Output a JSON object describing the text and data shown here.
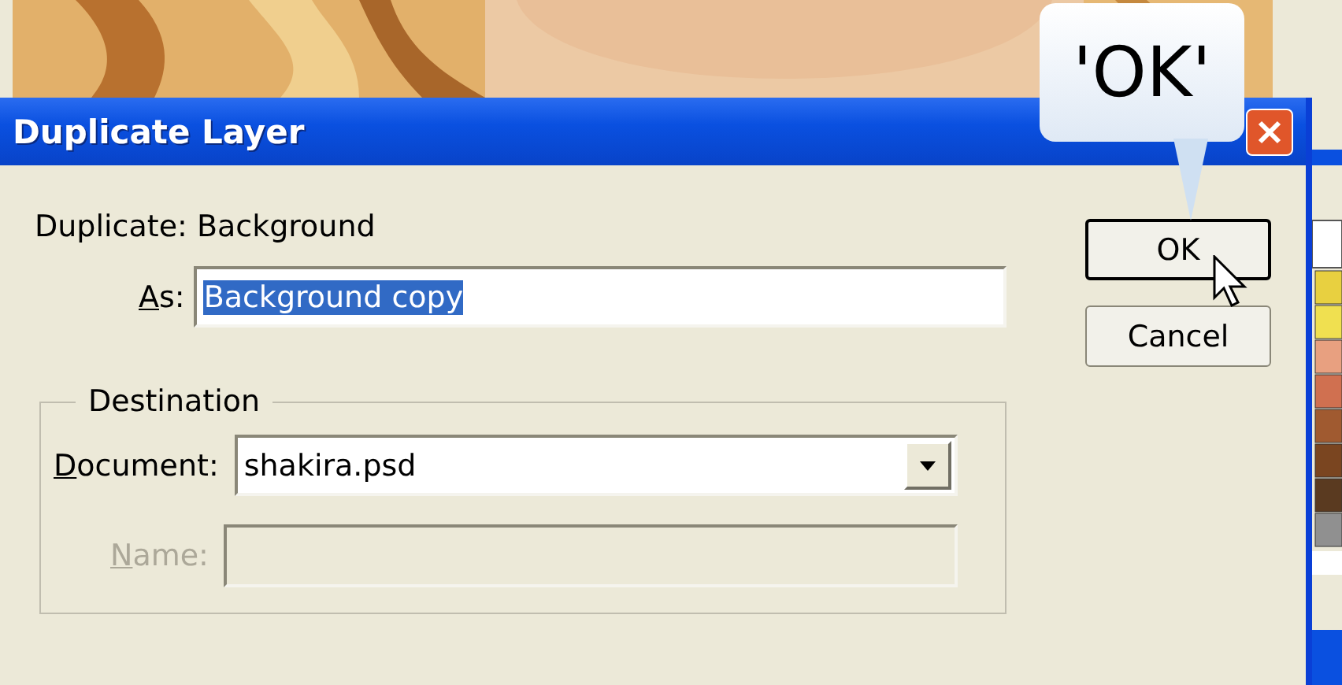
{
  "dialog": {
    "title": "Duplicate Layer",
    "source_label": "Duplicate: Background",
    "as_field": {
      "access_key": "A",
      "label_rest": "s:",
      "value": "Background copy",
      "text_selected": true
    },
    "destination": {
      "legend": "Destination",
      "document": {
        "access_key": "D",
        "label_rest": "ocument:",
        "value": "shakira.psd"
      },
      "name": {
        "access_key": "N",
        "label_rest": "ame:",
        "disabled": true
      }
    },
    "buttons": [
      {
        "label": "OK",
        "focused": true
      },
      {
        "label": "Cancel",
        "focused": false
      }
    ]
  },
  "callout": {
    "text": "'OK'"
  }
}
